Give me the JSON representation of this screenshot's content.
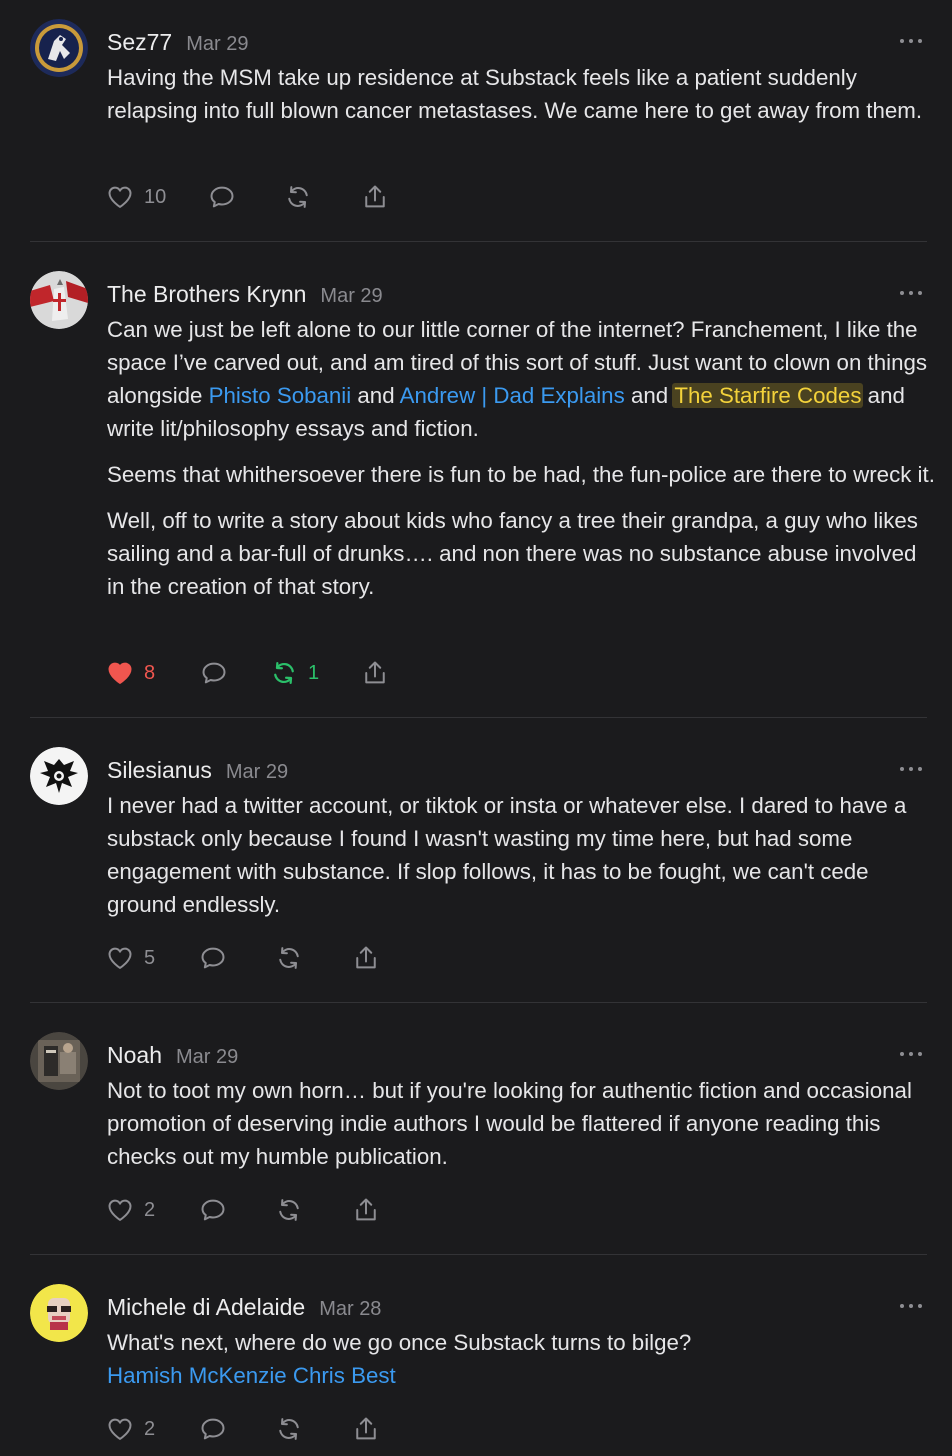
{
  "comments": [
    {
      "author": "Sez77",
      "date": "Mar 29",
      "paragraphs": [
        "Having the MSM take up residence at Substack feels like a patient suddenly relapsing into full blown cancer metastases. We came here to get away from them."
      ],
      "likes": "10",
      "restacks": "",
      "liked": false
    },
    {
      "author": "The Brothers Krynn",
      "date": "Mar 29",
      "p1_a": "Can we just be left alone to our little corner of the internet? Franchement, I like the space I’ve carved out, and am tired of this sort of stuff. Just want to clown on things alongside ",
      "mention1": "Phisto Sobanii",
      "p1_b": " and ",
      "mention2": "Andrew | Dad Explains",
      "p1_c": " and ",
      "mention3": "The Starfire Codes",
      "p1_d": " and write lit/philosophy essays and fiction.",
      "p2": "Seems that whithersoever there is fun to be had, the fun-police are there to wreck it.",
      "p3": "Well, off to write a story about kids who fancy a tree their grandpa, a guy who likes sailing and a bar-full of drunks…. and non there was no substance abuse involved in the creation of that story.",
      "likes": "8",
      "restacks": "1",
      "liked": true
    },
    {
      "author": "Silesianus",
      "date": "Mar 29",
      "paragraphs": [
        "I never had a twitter account, or tiktok or insta or whatever else. I dared to have a substack only because I found I wasn't wasting my time here, but had some engagement with substance. If slop follows, it has to be fought, we can't cede ground endlessly."
      ],
      "likes": "5",
      "restacks": "",
      "liked": false
    },
    {
      "author": "Noah",
      "date": "Mar 29",
      "paragraphs": [
        "Not to toot my own horn… but if you're looking for authentic fiction and occasional promotion of deserving indie authors I would be flattered if anyone reading this checks out my humble publication."
      ],
      "likes": "2",
      "restacks": "",
      "liked": false
    },
    {
      "author": "Michele di Adelaide",
      "date": "Mar 28",
      "text": "What's next, where do we go once Substack turns to bilge?",
      "mention1": "Hamish McKenzie",
      "mention2": "Chris Best",
      "likes": "2",
      "restacks": "",
      "liked": false
    }
  ],
  "colors": {
    "background": "#1b1b1d",
    "mention": "#3b9af0",
    "highlight_text": "#f3d23b",
    "like_active": "#f0564f",
    "restack_active": "#2bc06a",
    "muted": "#8e8e93"
  },
  "icons": [
    "heart-icon",
    "comment-icon",
    "restack-icon",
    "share-icon",
    "more-icon"
  ]
}
